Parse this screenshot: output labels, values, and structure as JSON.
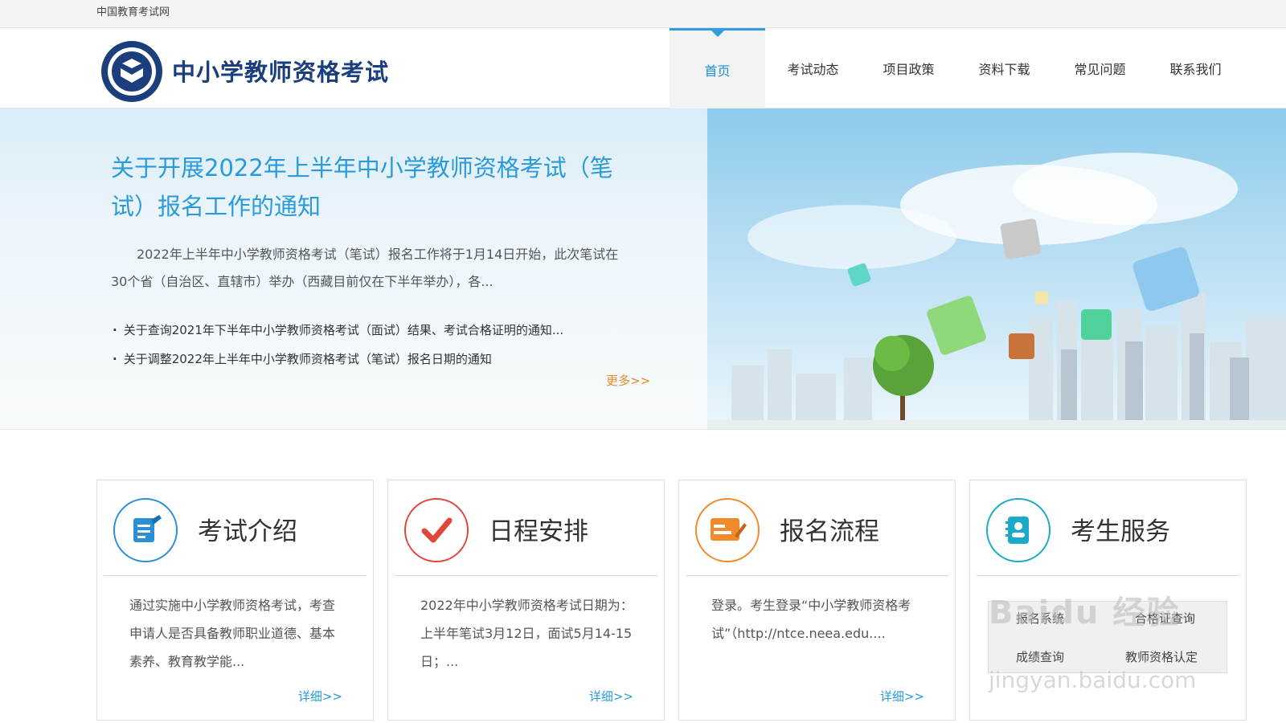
{
  "topbar": {
    "site_name": "中国教育考试网"
  },
  "header": {
    "brand": "中小学教师资格考试",
    "nav": [
      {
        "label": "首页",
        "active": true
      },
      {
        "label": "考试动态",
        "active": false
      },
      {
        "label": "项目政策",
        "active": false
      },
      {
        "label": "资料下载",
        "active": false
      },
      {
        "label": "常见问题",
        "active": false
      },
      {
        "label": "联系我们",
        "active": false
      }
    ]
  },
  "banner": {
    "headline": "关于开展2022年上半年中小学教师资格考试（笔试）报名工作的通知",
    "summary": "2022年上半年中小学教师资格考试（笔试）报名工作将于1月14日开始，此次笔试在30个省（自治区、直辖市）举办（西藏目前仅在下半年举办），各...",
    "news": [
      "关于查询2021年下半年中小学教师资格考试（面试）结果、考试合格证明的通知...",
      "关于调整2022年上半年中小学教师资格考试（笔试）报名日期的通知"
    ],
    "more": "更多>>"
  },
  "cards": [
    {
      "title": "考试介绍",
      "icon": "document-edit-icon",
      "color": "#2a8fd6",
      "desc": "通过实施中小学教师资格考试，考查申请人是否具备教师职业道德、基本素养、教育教学能...",
      "detail": "详细>>"
    },
    {
      "title": "日程安排",
      "icon": "checkmark-icon",
      "color": "#e0473a",
      "desc": "2022年中小学教师资格考试日期为：上半年笔试3月12日，面试5月14-15日；...",
      "detail": "详细>>"
    },
    {
      "title": "报名流程",
      "icon": "registration-form-icon",
      "color": "#f08a2b",
      "desc": "登录。考生登录“中小学教师资格考试”（http://ntce.neea.edu....",
      "detail": "详细>>"
    },
    {
      "title": "考生服务",
      "icon": "contact-book-icon",
      "color": "#1aa9c7",
      "services": [
        "报名系统",
        "合格证查询",
        "成绩查询",
        "教师资格认定"
      ]
    }
  ],
  "watermark": {
    "text": "Baidu 经验",
    "url": "jingyan.baidu.com"
  }
}
